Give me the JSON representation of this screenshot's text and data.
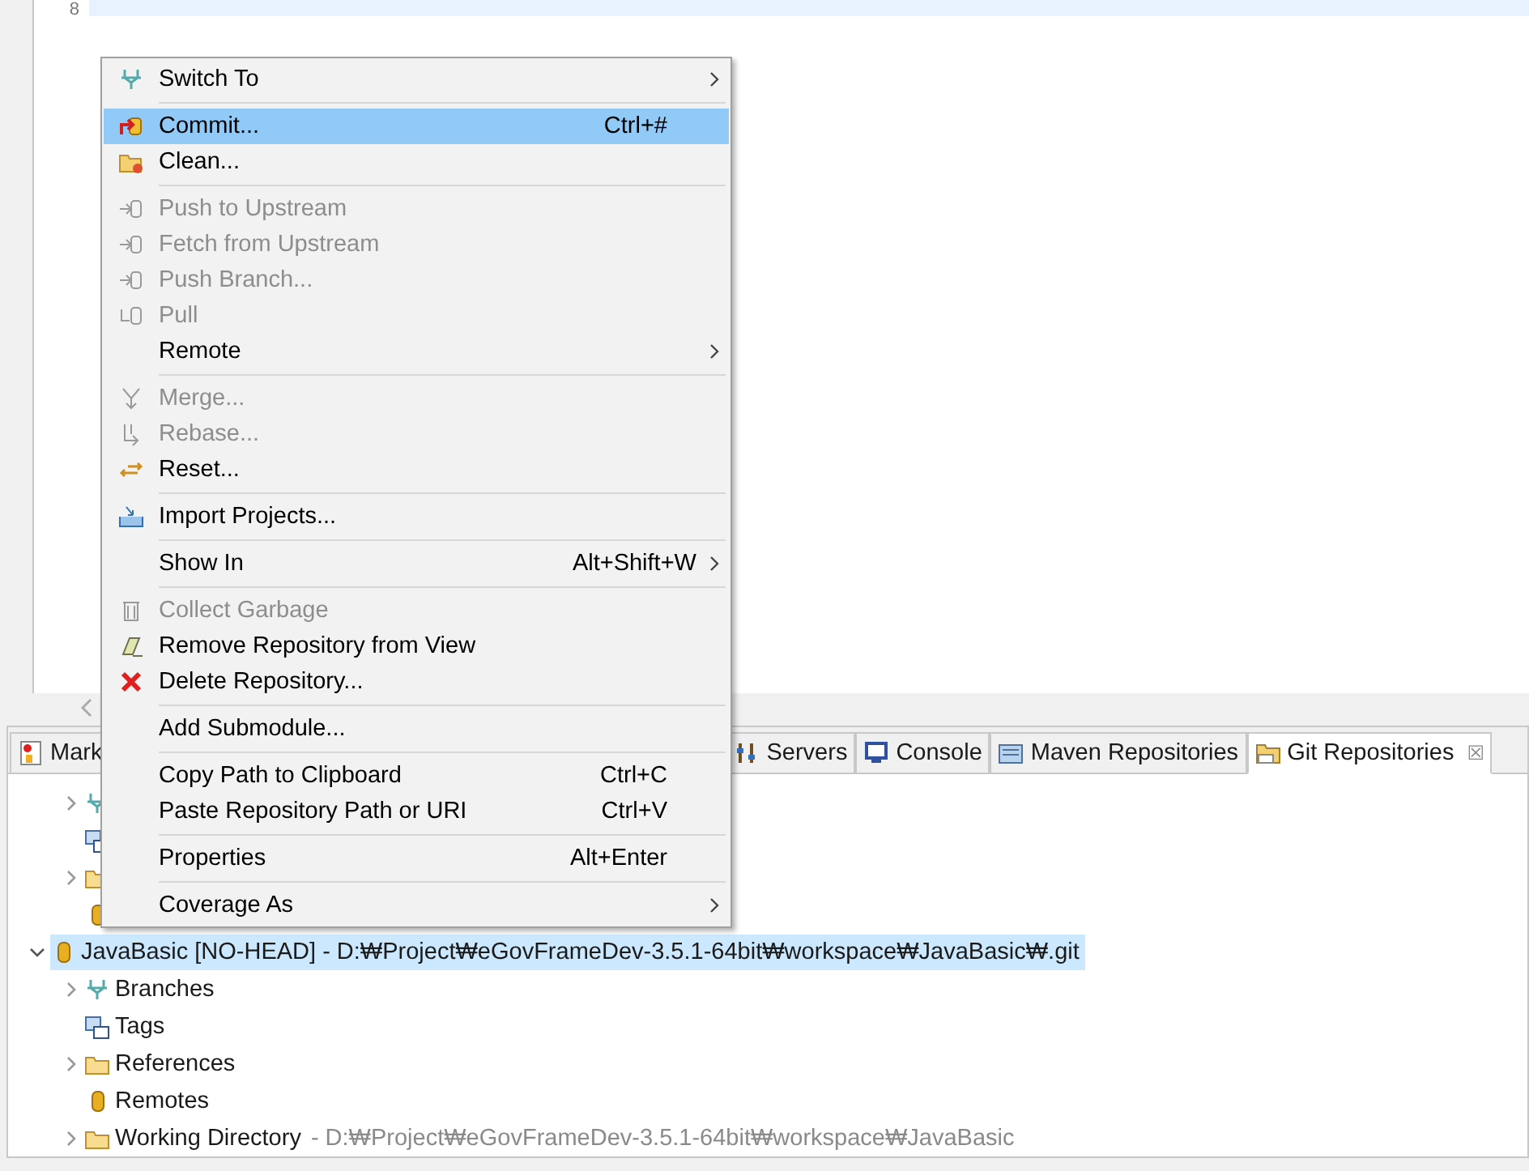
{
  "editor": {
    "line_number": "8"
  },
  "panel_tabs": [
    {
      "label": "Mark",
      "selected": false
    },
    {
      "label": "Servers",
      "selected": false
    },
    {
      "label": "Console",
      "selected": false
    },
    {
      "label": "Maven Repositories",
      "selected": false
    },
    {
      "label": "Git Repositories",
      "selected": true,
      "close": "☒"
    }
  ],
  "tree": [
    {
      "expandable": true,
      "expanded": false
    },
    {
      "expandable": false
    },
    {
      "expandable": true,
      "expanded": false
    },
    {
      "expandable": false
    },
    {
      "label": "JavaBasic [NO-HEAD] - D:₩Project₩eGovFrameDev-3.5.1-64bit₩workspace₩JavaBasic₩.git",
      "expandable": true,
      "expanded": true,
      "selected": true,
      "children": [
        {
          "label": "Branches",
          "expandable": true,
          "expanded": false,
          "selected": false
        },
        {
          "label": "Tags",
          "expandable": false,
          "selected": false
        },
        {
          "label": "References",
          "expandable": true,
          "expanded": false,
          "selected": false
        },
        {
          "label": "Remotes",
          "expandable": false,
          "selected": false
        },
        {
          "label": "Working Directory",
          "detail": "- D:₩Project₩eGovFrameDev-3.5.1-64bit₩workspace₩JavaBasic",
          "expandable": true,
          "expanded": false,
          "selected": false
        }
      ]
    }
  ],
  "context_menu": [
    {
      "kind": "item",
      "label": "Switch To",
      "submenu": true,
      "disabled": false,
      "selected": false
    },
    {
      "kind": "separator"
    },
    {
      "kind": "item",
      "label": "Commit...",
      "shortcut": "Ctrl+#",
      "disabled": false,
      "selected": true
    },
    {
      "kind": "item",
      "label": "Clean...",
      "disabled": false,
      "selected": false
    },
    {
      "kind": "separator"
    },
    {
      "kind": "item",
      "label": "Push to Upstream",
      "disabled": true,
      "selected": false
    },
    {
      "kind": "item",
      "label": "Fetch from Upstream",
      "disabled": true,
      "selected": false
    },
    {
      "kind": "item",
      "label": "Push Branch...",
      "disabled": true,
      "selected": false
    },
    {
      "kind": "item",
      "label": "Pull",
      "disabled": true,
      "selected": false
    },
    {
      "kind": "item",
      "label": "Remote",
      "submenu": true,
      "disabled": false,
      "selected": false
    },
    {
      "kind": "separator"
    },
    {
      "kind": "item",
      "label": "Merge...",
      "disabled": true,
      "selected": false
    },
    {
      "kind": "item",
      "label": "Rebase...",
      "disabled": true,
      "selected": false
    },
    {
      "kind": "item",
      "label": "Reset...",
      "disabled": false,
      "selected": false
    },
    {
      "kind": "separator"
    },
    {
      "kind": "item",
      "label": "Import Projects...",
      "disabled": false,
      "selected": false
    },
    {
      "kind": "separator"
    },
    {
      "kind": "item",
      "label": "Show In",
      "shortcut": "Alt+Shift+W",
      "submenu": true,
      "disabled": false,
      "selected": false
    },
    {
      "kind": "separator"
    },
    {
      "kind": "item",
      "label": "Collect Garbage",
      "disabled": true,
      "selected": false
    },
    {
      "kind": "item",
      "label": "Remove Repository from View",
      "disabled": false,
      "selected": false
    },
    {
      "kind": "item",
      "label": "Delete Repository...",
      "disabled": false,
      "selected": false
    },
    {
      "kind": "separator"
    },
    {
      "kind": "item",
      "label": "Add Submodule...",
      "disabled": false,
      "selected": false
    },
    {
      "kind": "separator"
    },
    {
      "kind": "item",
      "label": "Copy Path to Clipboard",
      "shortcut": "Ctrl+C",
      "disabled": false,
      "selected": false
    },
    {
      "kind": "item",
      "label": "Paste Repository Path or URI",
      "shortcut": "Ctrl+V",
      "disabled": false,
      "selected": false
    },
    {
      "kind": "separator"
    },
    {
      "kind": "item",
      "label": "Properties",
      "shortcut": "Alt+Enter",
      "disabled": false,
      "selected": false
    },
    {
      "kind": "separator"
    },
    {
      "kind": "item",
      "label": "Coverage As",
      "submenu": true,
      "disabled": false,
      "selected": false
    }
  ]
}
